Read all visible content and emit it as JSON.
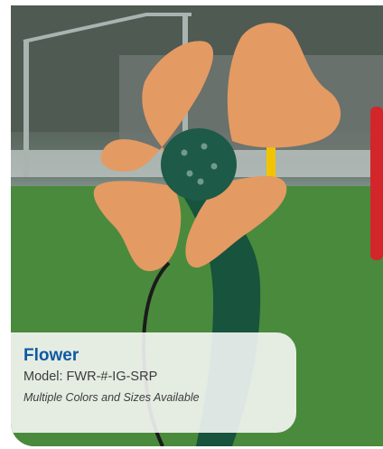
{
  "product": {
    "title": "Flower",
    "model": "Model: FWR-#-IG-SRP",
    "availability": "Multiple Colors and Sizes Available"
  },
  "colors": {
    "petal": "#e49a63",
    "center": "#1d5a47",
    "stem": "#17533d",
    "title": "#0f5aa1"
  }
}
